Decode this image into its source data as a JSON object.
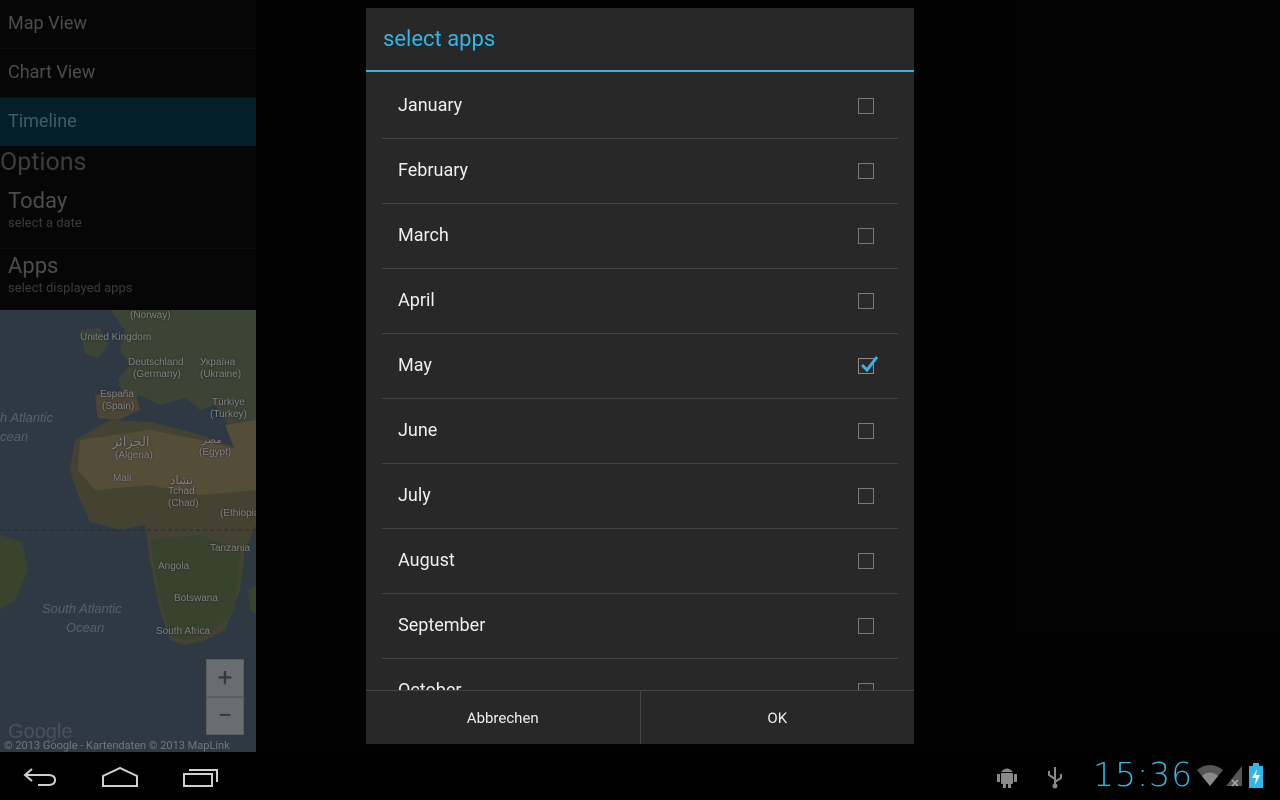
{
  "nav": {
    "items": [
      {
        "label": "Map View",
        "active": false
      },
      {
        "label": "Chart View",
        "active": false
      },
      {
        "label": "Timeline",
        "active": true
      }
    ]
  },
  "options": {
    "heading": "Options",
    "items": [
      {
        "title": "Today",
        "subtitle": "select a date"
      },
      {
        "title": "Apps",
        "subtitle": "select displayed apps"
      }
    ]
  },
  "map": {
    "labels": {
      "norway": "(Norway)",
      "uk": "United Kingdom",
      "germany1": "Deutschland",
      "germany2": "(Germany)",
      "ukraine1": "Україна",
      "ukraine2": "(Ukraine)",
      "spain1": "España",
      "spain2": "(Spain)",
      "turkey1": "Türkiye",
      "turkey2": "(Turkey)",
      "algeria1": "الجزائر",
      "algeria2": "(Algeria)",
      "egypt1": "مصر",
      "egypt2": "(Egypt)",
      "mali": "Mali",
      "chad1": "تشاد",
      "chad2": "Tchad",
      "chad3": "(Chad)",
      "ethiopia": "(Ethiopia",
      "tanzania": "Tanzania",
      "angola": "Angola",
      "botswana": "Botswana",
      "southafrica": "South Africa",
      "atlantic1": "h Atlantic",
      "atlantic2": "cean",
      "satlantic1": "South Atlantic",
      "satlantic2": "Ocean"
    },
    "zoom_in": "+",
    "zoom_out": "−",
    "logo": "Google",
    "copyright": "© 2013 Google - Kartendaten © 2013 MapLink"
  },
  "dialog": {
    "title": "select apps",
    "items": [
      {
        "label": "January",
        "checked": false
      },
      {
        "label": "February",
        "checked": false
      },
      {
        "label": "March",
        "checked": false
      },
      {
        "label": "April",
        "checked": false
      },
      {
        "label": "May",
        "checked": true
      },
      {
        "label": "June",
        "checked": false
      },
      {
        "label": "July",
        "checked": false
      },
      {
        "label": "August",
        "checked": false
      },
      {
        "label": "September",
        "checked": false
      },
      {
        "label": "October",
        "checked": false
      }
    ],
    "cancel_label": "Abbrechen",
    "ok_label": "OK"
  },
  "system_bar": {
    "clock": "15:36",
    "accent": "#33b5e5",
    "icons": [
      "back-icon",
      "home-icon",
      "recent-apps-icon",
      "android-debug-icon",
      "usb-icon",
      "wifi-icon",
      "signal-icon",
      "battery-charging-icon"
    ]
  }
}
